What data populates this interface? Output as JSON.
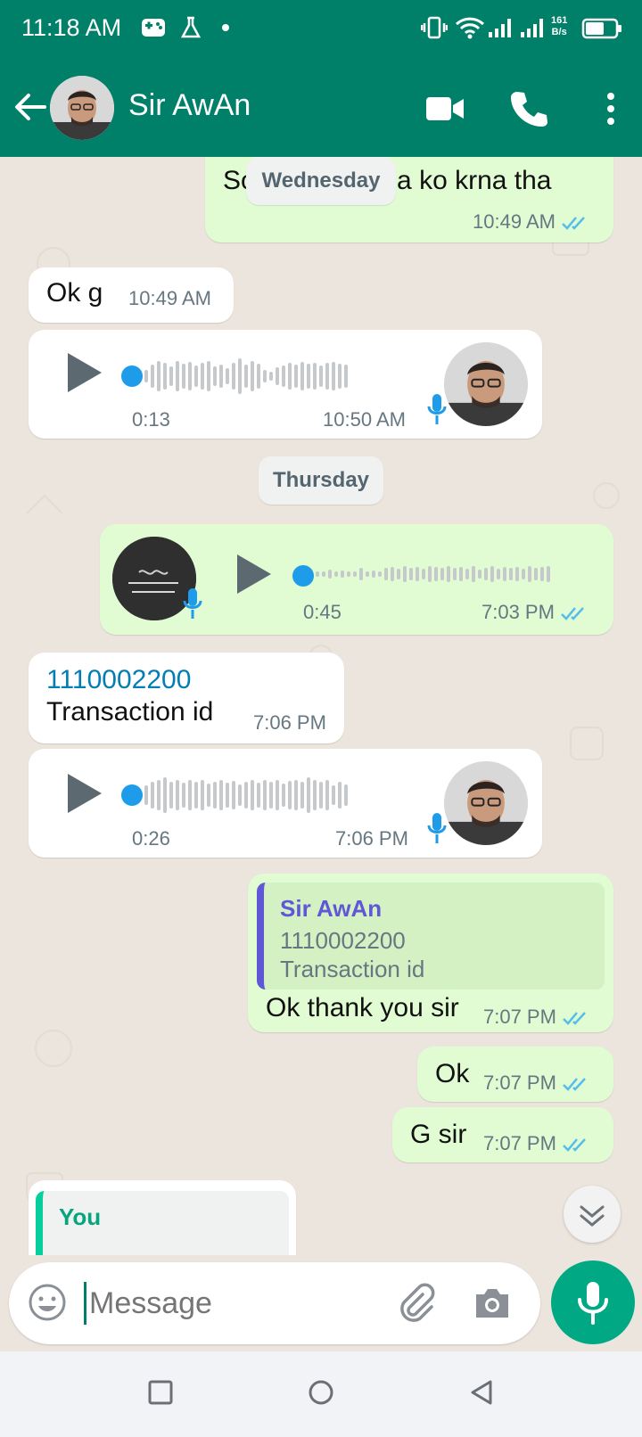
{
  "status_bar": {
    "time": "11:18 AM",
    "netspeed_top": "161",
    "netspeed_bottom": "B/s",
    "icons": [
      "game-controller-icon",
      "flask-icon",
      "dot-icon",
      "vibrate-icon",
      "wifi-icon",
      "signal-icon",
      "signal-icon",
      "battery-icon"
    ]
  },
  "header": {
    "contact_name": "Sir AwAn",
    "icons": [
      "back-arrow-icon",
      "video-call-icon",
      "phone-icon",
      "more-vert-icon"
    ]
  },
  "colors": {
    "brand": "#008069",
    "outgoing_bubble": "#e1fbd3",
    "incoming_bubble": "#ffffff",
    "tick_blue": "#53bdeb",
    "quote_accent": "#5f57d6",
    "voice_dot": "#1e9be9"
  },
  "messages": {
    "m1": {
      "text": "Sorry wo Salma ko krna tha",
      "time": "10:49 AM"
    },
    "day1": "Wednesday",
    "m2": {
      "text": "Ok g",
      "time": "10:49 AM"
    },
    "v1": {
      "duration": "0:13",
      "time": "10:50 AM"
    },
    "day2": "Thursday",
    "v2": {
      "duration": "0:45",
      "time": "7:03 PM"
    },
    "m3": {
      "link": "1110002200",
      "text": "Transaction id",
      "time": "7:06 PM"
    },
    "v3": {
      "duration": "0:26",
      "time": "7:06 PM"
    },
    "m4": {
      "quote_name": "Sir AwAn",
      "quote_line1": "1110002200",
      "quote_line2": "Transaction id",
      "text": "Ok thank you sir",
      "time": "7:07 PM"
    },
    "m5": {
      "text": "Ok",
      "time": "7:07 PM"
    },
    "m6": {
      "text": "G sir",
      "time": "7:07 PM"
    },
    "m7": {
      "quote_name": "You"
    }
  },
  "input": {
    "placeholder": "Message",
    "icons": [
      "emoji-icon",
      "attach-icon",
      "camera-icon",
      "mic-icon"
    ]
  },
  "nav": {
    "icons": [
      "recents-square-icon",
      "home-circle-icon",
      "back-triangle-icon"
    ]
  }
}
